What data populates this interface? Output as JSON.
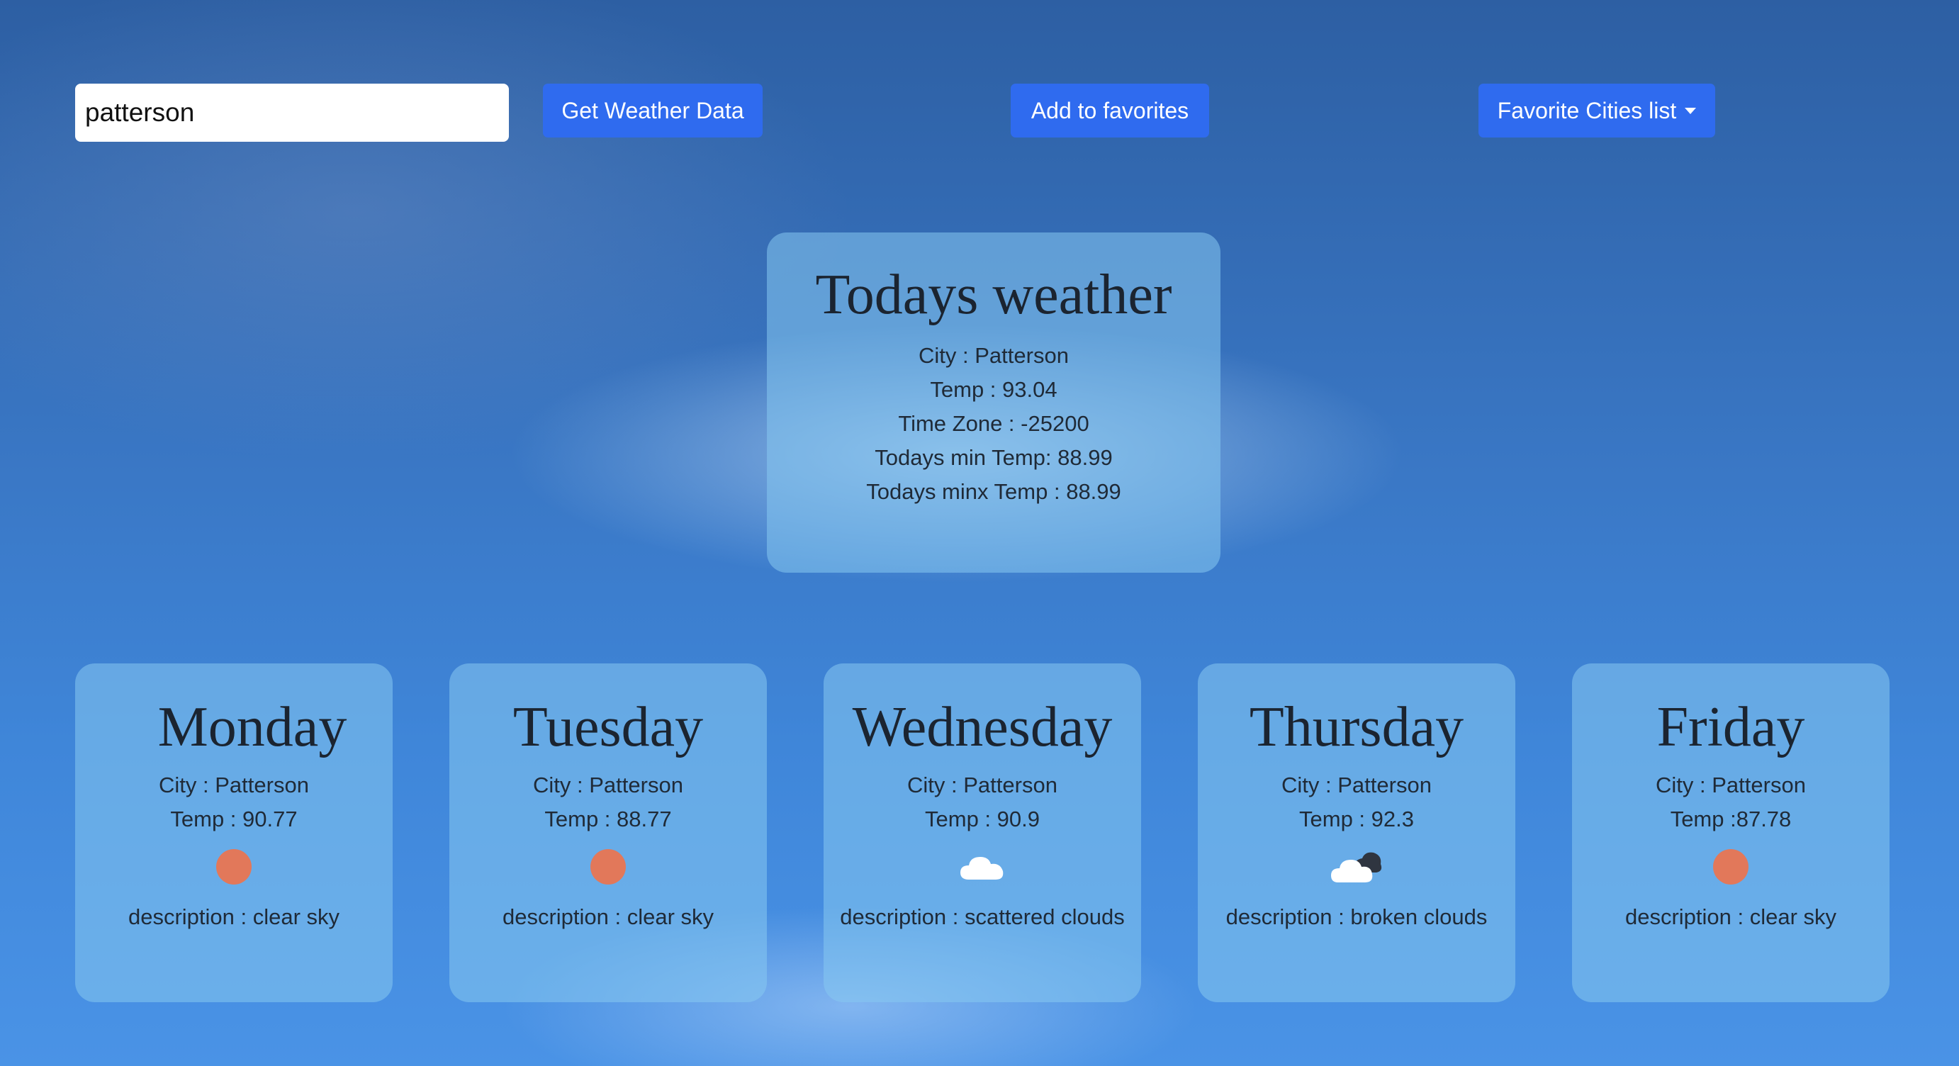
{
  "search": {
    "value": "patterson"
  },
  "toolbar": {
    "get_weather_label": "Get Weather Data",
    "add_favorite_label": "Add to favorites",
    "favorites_list_label": "Favorite Cities list"
  },
  "today": {
    "title": "Todays weather",
    "city": "City : Patterson",
    "temp": "Temp : 93.04",
    "timezone": "Time Zone : -25200",
    "min_temp": "Todays min Temp: 88.99",
    "max_temp": "Todays minx Temp : 88.99"
  },
  "forecast": [
    {
      "day": "Monday",
      "city": "City : Patterson",
      "temp": "Temp : 90.77",
      "icon": "sun-icon",
      "description": "description : clear sky"
    },
    {
      "day": "Tuesday",
      "city": "City : Patterson",
      "temp": "Temp : 88.77",
      "icon": "sun-icon",
      "description": "description : clear sky"
    },
    {
      "day": "Wednesday",
      "city": "City : Patterson",
      "temp": "Temp : 90.9",
      "icon": "cloud-icon",
      "description": "description : scattered clouds"
    },
    {
      "day": "Thursday",
      "city": "City : Patterson",
      "temp": "Temp : 92.3",
      "icon": "broken-clouds-icon",
      "description": "description : broken clouds"
    },
    {
      "day": "Friday",
      "city": "City : Patterson",
      "temp": "Temp :87.78",
      "icon": "sun-icon",
      "description": "description : clear sky"
    }
  ],
  "colors": {
    "button": "#2f6bef",
    "sun": "#e2785a",
    "card": "rgba(135,200,240,0.55)"
  }
}
